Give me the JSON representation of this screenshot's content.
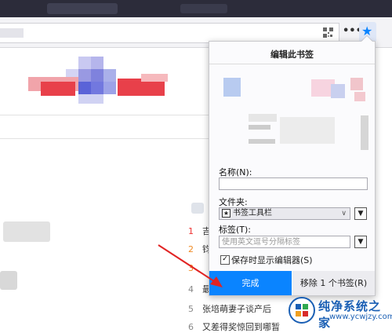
{
  "panel": {
    "title": "编辑此书签",
    "name_label": "名称(N):",
    "name_value": "",
    "folder_label": "文件夹:",
    "folder_value": "书签工具栏",
    "tags_label": "标签(T):",
    "tags_placeholder": "使用英文逗号分隔标签",
    "show_editor_label": "保存时显示编辑器(S)",
    "show_editor_checked": true,
    "done_label": "完成",
    "remove_label": "移除 1 个书签(R)"
  },
  "toolbar": {
    "more_label": "•••",
    "bookmark_star": "★"
  },
  "list": [
    {
      "num": "1",
      "text": "吉",
      "color": "red"
    },
    {
      "num": "2",
      "text": "钧",
      "color": "orange"
    },
    {
      "num": "3",
      "text": "",
      "color": "orange"
    },
    {
      "num": "4",
      "text": "最",
      "color": "gray"
    },
    {
      "num": "5",
      "text": "张培萌妻子谈产后",
      "color": "gray"
    },
    {
      "num": "6",
      "text": "又差得奖惊回到哪暂",
      "color": "gray"
    }
  ],
  "watermark": {
    "title": "纯净系统之家",
    "url": "www.ycwjzy.com"
  },
  "colors": {
    "accent": "#0a84ff",
    "mosaic_red": "#e8404a",
    "mosaic_blue": "#5a63d8"
  }
}
